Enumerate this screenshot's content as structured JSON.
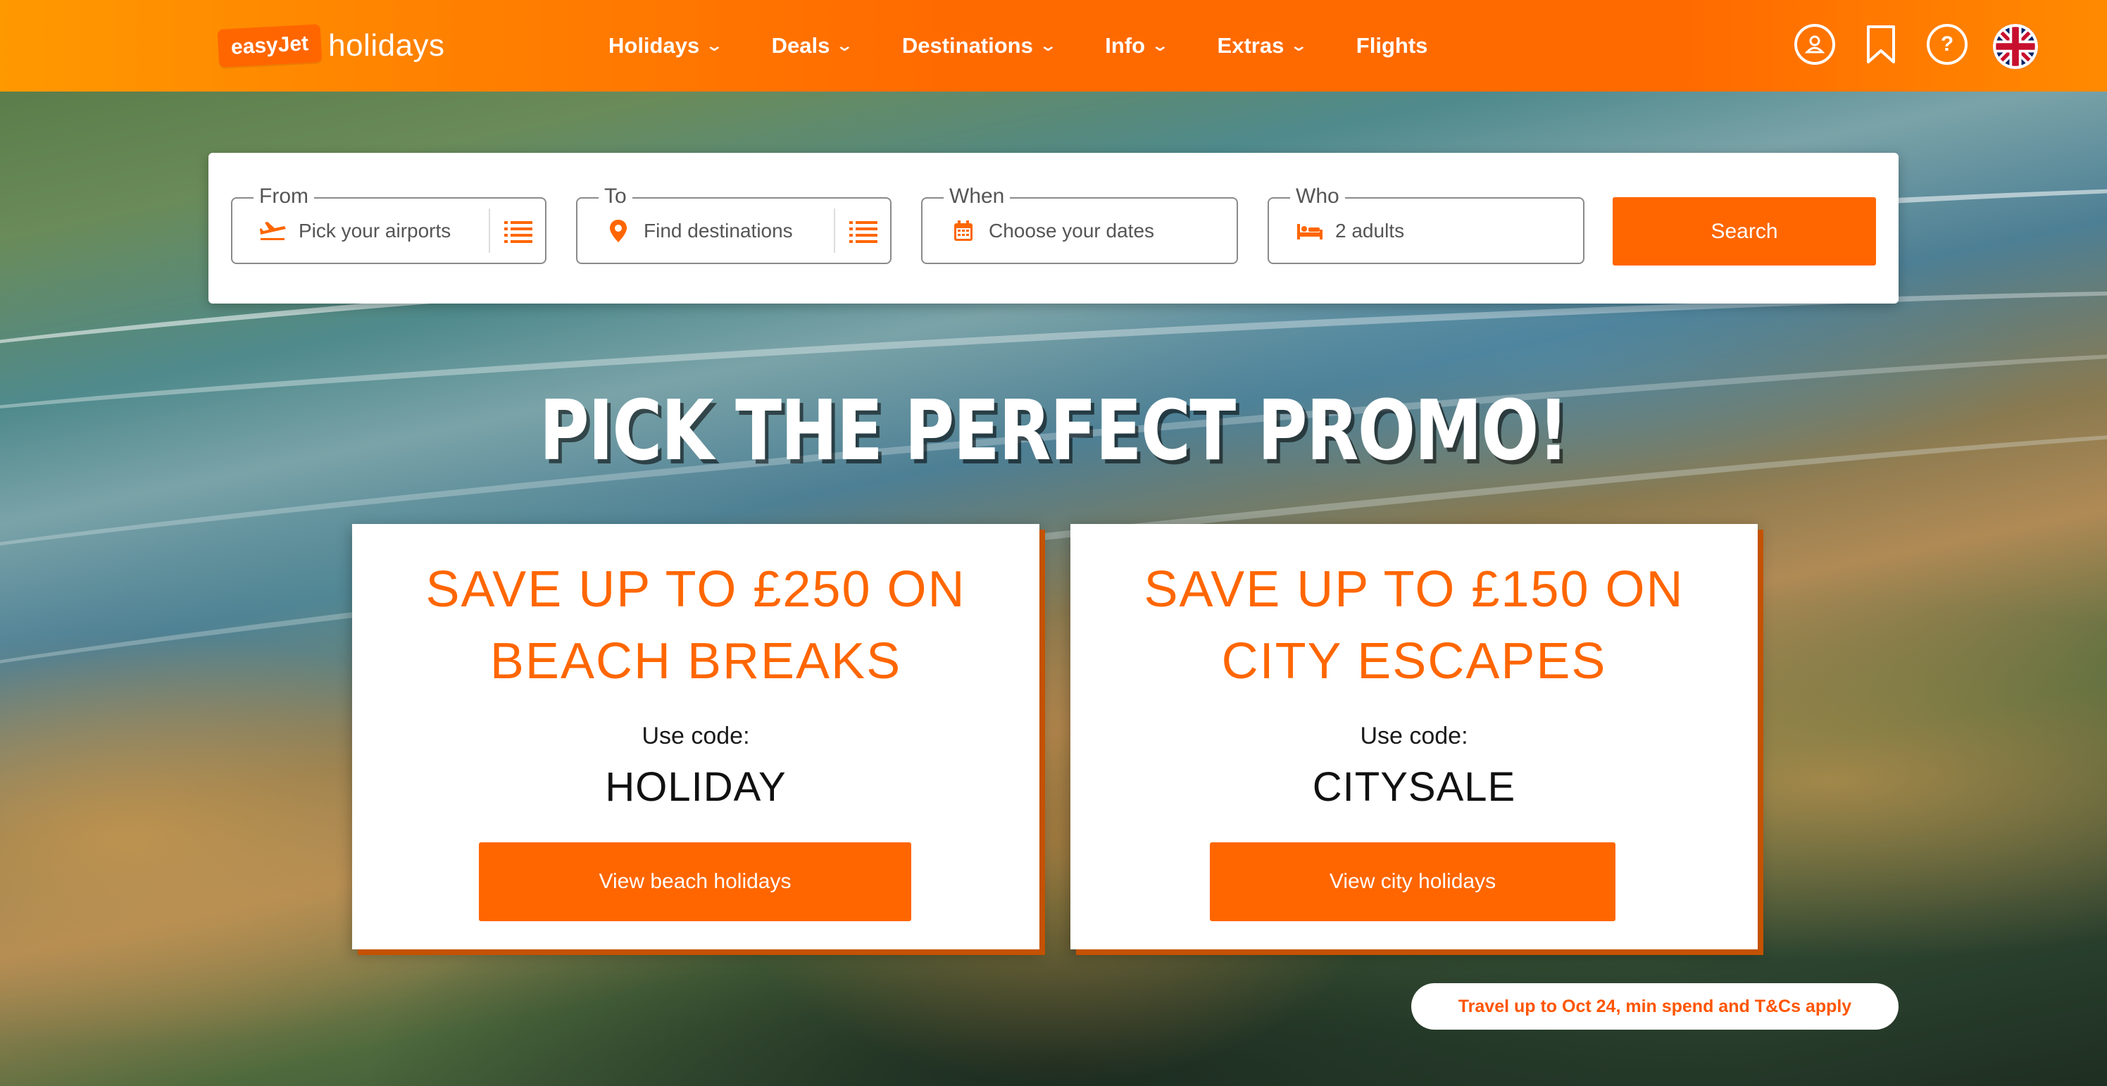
{
  "brand": {
    "logo_mark": "easyJet",
    "logo_text": "holidays",
    "accent_color": "#ff6600"
  },
  "nav": {
    "items": [
      {
        "label": "Holidays",
        "has_dropdown": true
      },
      {
        "label": "Deals",
        "has_dropdown": true
      },
      {
        "label": "Destinations",
        "has_dropdown": true
      },
      {
        "label": "Info",
        "has_dropdown": true
      },
      {
        "label": "Extras",
        "has_dropdown": true
      },
      {
        "label": "Flights",
        "has_dropdown": false
      }
    ],
    "icons": [
      "account-icon",
      "bookmark-icon",
      "help-icon",
      "uk-flag-icon"
    ],
    "help_glyph": "?"
  },
  "search": {
    "from": {
      "legend": "From",
      "placeholder": "Pick your airports",
      "icon": "plane-icon"
    },
    "to": {
      "legend": "To",
      "placeholder": "Find destinations",
      "icon": "location-pin-icon"
    },
    "when": {
      "legend": "When",
      "placeholder": "Choose your dates",
      "icon": "calendar-icon"
    },
    "who": {
      "legend": "Who",
      "value": "2 adults",
      "icon": "bed-icon"
    },
    "button_label": "Search"
  },
  "headline": "PICK THE PERFECT PROMO!",
  "promos": [
    {
      "title_line1": "SAVE UP TO £250 ON",
      "title_line2": "BEACH BREAKS",
      "use_code_label": "Use code:",
      "code": "HOLIDAY",
      "button_label": "View beach holidays"
    },
    {
      "title_line1": "SAVE UP TO £150 ON",
      "title_line2": "CITY ESCAPES",
      "use_code_label": "Use code:",
      "code": "CITYSALE",
      "button_label": "View city holidays"
    }
  ],
  "terms": "Travel up to Oct 24, min spend and T&Cs apply"
}
